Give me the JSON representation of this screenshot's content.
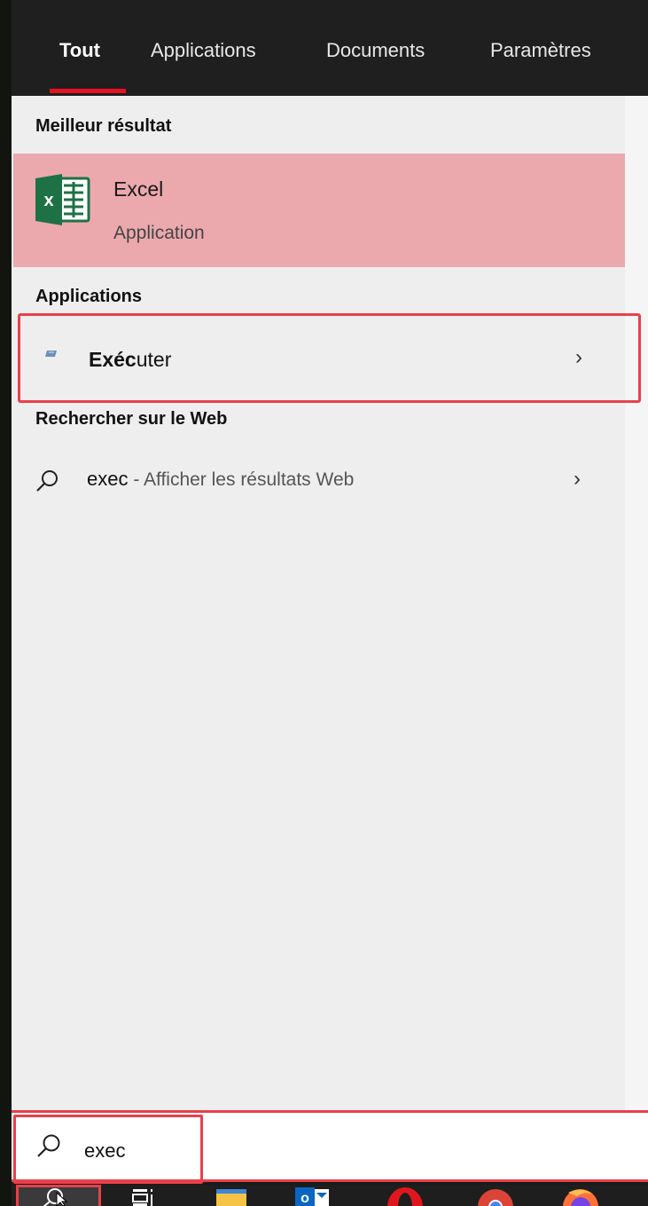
{
  "tabs": [
    {
      "label": "Tout"
    },
    {
      "label": "Applications"
    },
    {
      "label": "Documents"
    },
    {
      "label": "Paramètres"
    }
  ],
  "sections": {
    "best": "Meilleur résultat",
    "apps": "Applications",
    "web": "Rechercher sur le Web"
  },
  "best_result": {
    "title": "Excel",
    "subtitle": "Application"
  },
  "apps_result": {
    "label_bold": "Exéc",
    "label_rest": "uter"
  },
  "web_result": {
    "query": "exec",
    "suffix": " - Afficher les résultats Web"
  },
  "search": {
    "value": "exec"
  },
  "colors": {
    "accent": "#e81123",
    "highlight": "#e8404b",
    "best_bg": "#eba9ae",
    "excel_green": "#1e7145"
  },
  "taskbar_icons": [
    "search-icon",
    "task-view-icon",
    "file-explorer-icon",
    "outlook-icon",
    "opera-icon",
    "chrome-icon",
    "firefox-icon"
  ]
}
